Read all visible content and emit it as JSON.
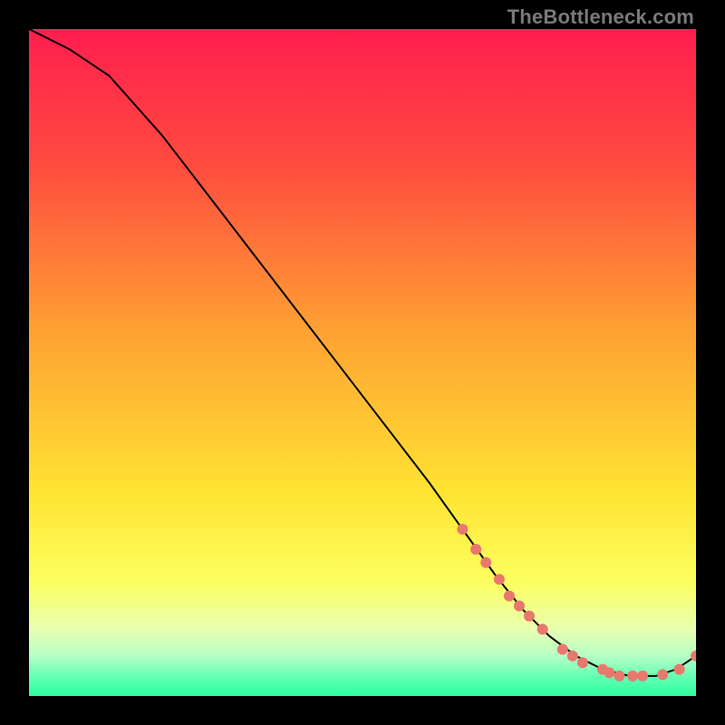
{
  "watermark": "TheBottleneck.com",
  "chart_data": {
    "type": "line",
    "title": "",
    "xlabel": "",
    "ylabel": "",
    "xlim": [
      0,
      100
    ],
    "ylim": [
      0,
      100
    ],
    "grid": false,
    "legend": false,
    "series": [
      {
        "name": "bottleneck-curve",
        "color": "#000000",
        "x": [
          0,
          6,
          12,
          20,
          30,
          40,
          50,
          60,
          65,
          70,
          74,
          78,
          82,
          86,
          90,
          94,
          97,
          100
        ],
        "values": [
          100,
          97,
          93,
          84,
          71,
          58,
          45,
          32,
          25,
          18,
          13,
          9,
          6,
          4,
          3,
          3,
          4,
          6
        ]
      }
    ],
    "markers": {
      "name": "highlight-points",
      "color": "#e9786c",
      "radius": 6,
      "x": [
        65,
        67,
        68.5,
        70.5,
        72,
        73.5,
        75,
        77,
        80,
        81.5,
        83,
        86,
        87,
        88.5,
        90.5,
        92,
        95,
        97.5,
        100
      ],
      "values": [
        25,
        22,
        20,
        17.5,
        15,
        13.5,
        12,
        10,
        7,
        6,
        5,
        4,
        3.5,
        3,
        3,
        3,
        3.2,
        4,
        6
      ]
    },
    "background_gradient_stops": [
      {
        "y_pct": 0,
        "color": "#ff1e4f"
      },
      {
        "y_pct": 20,
        "color": "#ff4a3f"
      },
      {
        "y_pct": 45,
        "color": "#ffa033"
      },
      {
        "y_pct": 70,
        "color": "#ffe533"
      },
      {
        "y_pct": 83,
        "color": "#fcff60"
      },
      {
        "y_pct": 90,
        "color": "#e8ffb0"
      },
      {
        "y_pct": 94,
        "color": "#b6ffc6"
      },
      {
        "y_pct": 97,
        "color": "#66ffb3"
      },
      {
        "y_pct": 100,
        "color": "#2bff9e"
      }
    ]
  }
}
